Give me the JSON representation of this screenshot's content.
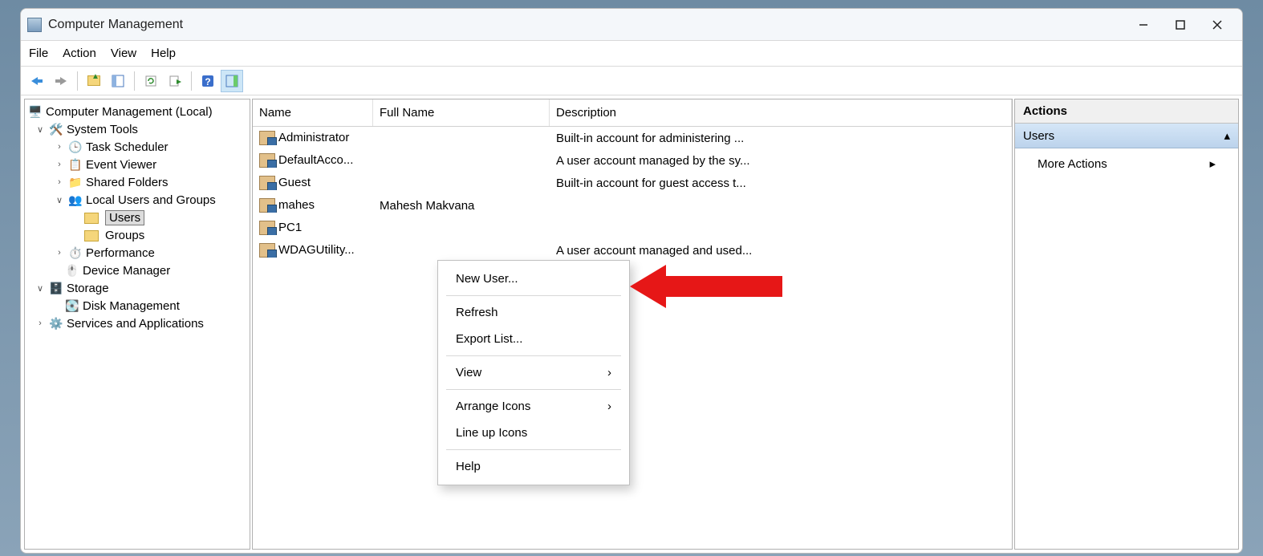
{
  "title": "Computer Management",
  "menus": {
    "file": "File",
    "action": "Action",
    "view": "View",
    "help": "Help"
  },
  "tree": {
    "root": "Computer Management (Local)",
    "system_tools": "System Tools",
    "task_scheduler": "Task Scheduler",
    "event_viewer": "Event Viewer",
    "shared_folders": "Shared Folders",
    "local_users_groups": "Local Users and Groups",
    "users": "Users",
    "groups": "Groups",
    "performance": "Performance",
    "device_manager": "Device Manager",
    "storage": "Storage",
    "disk_management": "Disk Management",
    "services_apps": "Services and Applications"
  },
  "columns": {
    "name": "Name",
    "fullname": "Full Name",
    "description": "Description"
  },
  "users": [
    {
      "name": "Administrator",
      "full": "",
      "desc": "Built-in account for administering ..."
    },
    {
      "name": "DefaultAcco...",
      "full": "",
      "desc": "A user account managed by the sy..."
    },
    {
      "name": "Guest",
      "full": "",
      "desc": "Built-in account for guest access t..."
    },
    {
      "name": "mahes",
      "full": "Mahesh Makvana",
      "desc": ""
    },
    {
      "name": "PC1",
      "full": "",
      "desc": ""
    },
    {
      "name": "WDAGUtility...",
      "full": "",
      "desc": "A user account managed and used..."
    }
  ],
  "context": {
    "new_user": "New User...",
    "refresh": "Refresh",
    "export": "Export List...",
    "view": "View",
    "arrange": "Arrange Icons",
    "lineup": "Line up Icons",
    "help": "Help"
  },
  "actions": {
    "header": "Actions",
    "users": "Users",
    "more": "More Actions"
  }
}
